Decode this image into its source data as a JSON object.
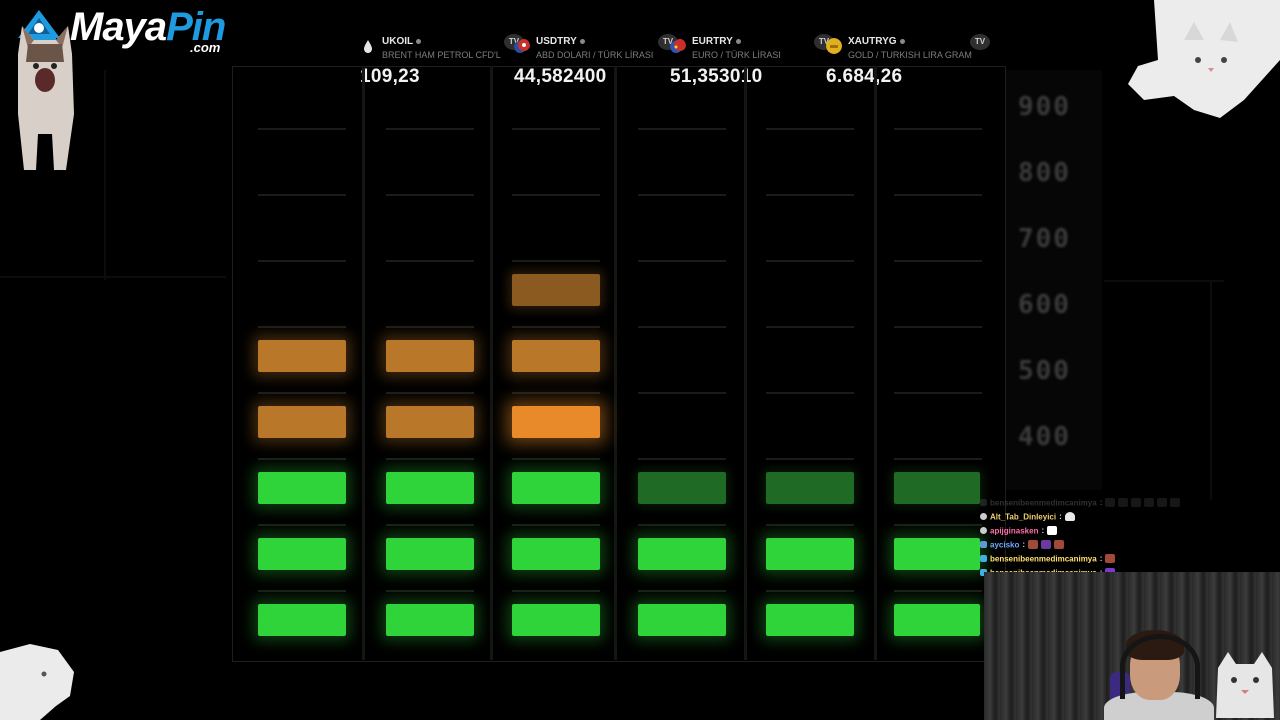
{
  "logo": {
    "part1": "Maya",
    "part2": "Pin",
    "sub": ".com"
  },
  "tickers": [
    {
      "symbol": "UKOIL",
      "name": "BRENT HAM PETROL CFD'L",
      "value": "109,23",
      "icon": "oil-drop-icon",
      "icon_color": "#e6e6e6"
    },
    {
      "symbol": "USDTRY",
      "name": "ABD DOLARI / TÜRK LİRASI",
      "value": "44,582400",
      "icon": "us-tr-flag-icon",
      "icon_color": "#c9302c"
    },
    {
      "symbol": "EURTRY",
      "name": "EURO / TÜRK LİRASI",
      "value": "51,353010",
      "icon": "eu-tr-flag-icon",
      "icon_color": "#2a55b8"
    },
    {
      "symbol": "XAUTRYG",
      "name": "GOLD / TURKISH LIRA GRAM",
      "value": "6.684,26",
      "icon": "gold-coin-icon",
      "icon_color": "#e0b020"
    }
  ],
  "ticker_badge": "TV",
  "meter": {
    "scale_labels": [
      "900",
      "800",
      "700",
      "600",
      "500",
      "400"
    ],
    "levels": [
      5,
      5,
      6,
      3,
      3,
      3
    ]
  },
  "chat": [
    {
      "user": "bensenibeenmedimcanimya",
      "color": "#8a8a8a",
      "badge_color": "#555555",
      "emotes": [
        "#444444",
        "#444444",
        "#444444",
        "#444444",
        "#444444",
        "#444444"
      ],
      "faded": true
    },
    {
      "user": "Alt_Tab_Dinleyici",
      "color": "#f0d070",
      "badge_color": "#cccccc",
      "emotes": [
        "#e8e8e8"
      ],
      "faded": false
    },
    {
      "user": "apijginasken",
      "color": "#ff6fa8",
      "badge_color": "#cccccc",
      "emotes": [
        "#ffffff"
      ],
      "faded": false
    },
    {
      "user": "aycisko",
      "color": "#6fa8ff",
      "badge_color": "#5a9ad8",
      "emotes": [
        "#a04a3a",
        "#6a3aa0",
        "#a04a3a"
      ],
      "faded": false
    },
    {
      "user": "bensenibeenmedimcanimya",
      "color": "#ffe070",
      "badge_color": "#3fb0e0",
      "emotes": [
        "#a04a3a"
      ],
      "faded": false
    },
    {
      "user": "bensenibeenmedimcanimya",
      "color": "#ffe070",
      "badge_color": "#3fb0e0",
      "emotes": [
        "#7a3ad0"
      ],
      "faded": false
    }
  ],
  "colors": {
    "green": "#2fd33a",
    "orange": "#e88a2a",
    "brand_blue": "#1e9be0"
  }
}
